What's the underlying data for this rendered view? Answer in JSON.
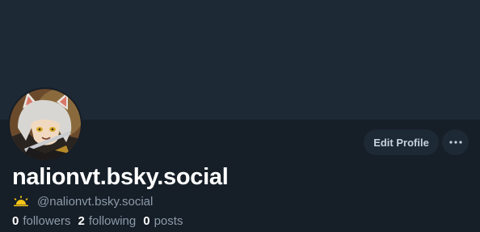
{
  "profile": {
    "display_name": "nalionvt.bsky.social",
    "handle": "@nalionvt.bsky.social",
    "edit_label": "Edit Profile",
    "more_icon": "ellipsis-icon",
    "handle_badge_icon": "sunrise-icon",
    "avatar_icon": "avatar-anime-character"
  },
  "stats": {
    "followers_count": "0",
    "followers_label": "followers",
    "following_count": "2",
    "following_label": "following",
    "posts_count": "0",
    "posts_label": "posts"
  },
  "colors": {
    "background": "#161e27",
    "banner": "#1e2936",
    "text_primary": "#ffffff",
    "text_secondary": "#8d9baa",
    "badge": "#f5c518"
  }
}
